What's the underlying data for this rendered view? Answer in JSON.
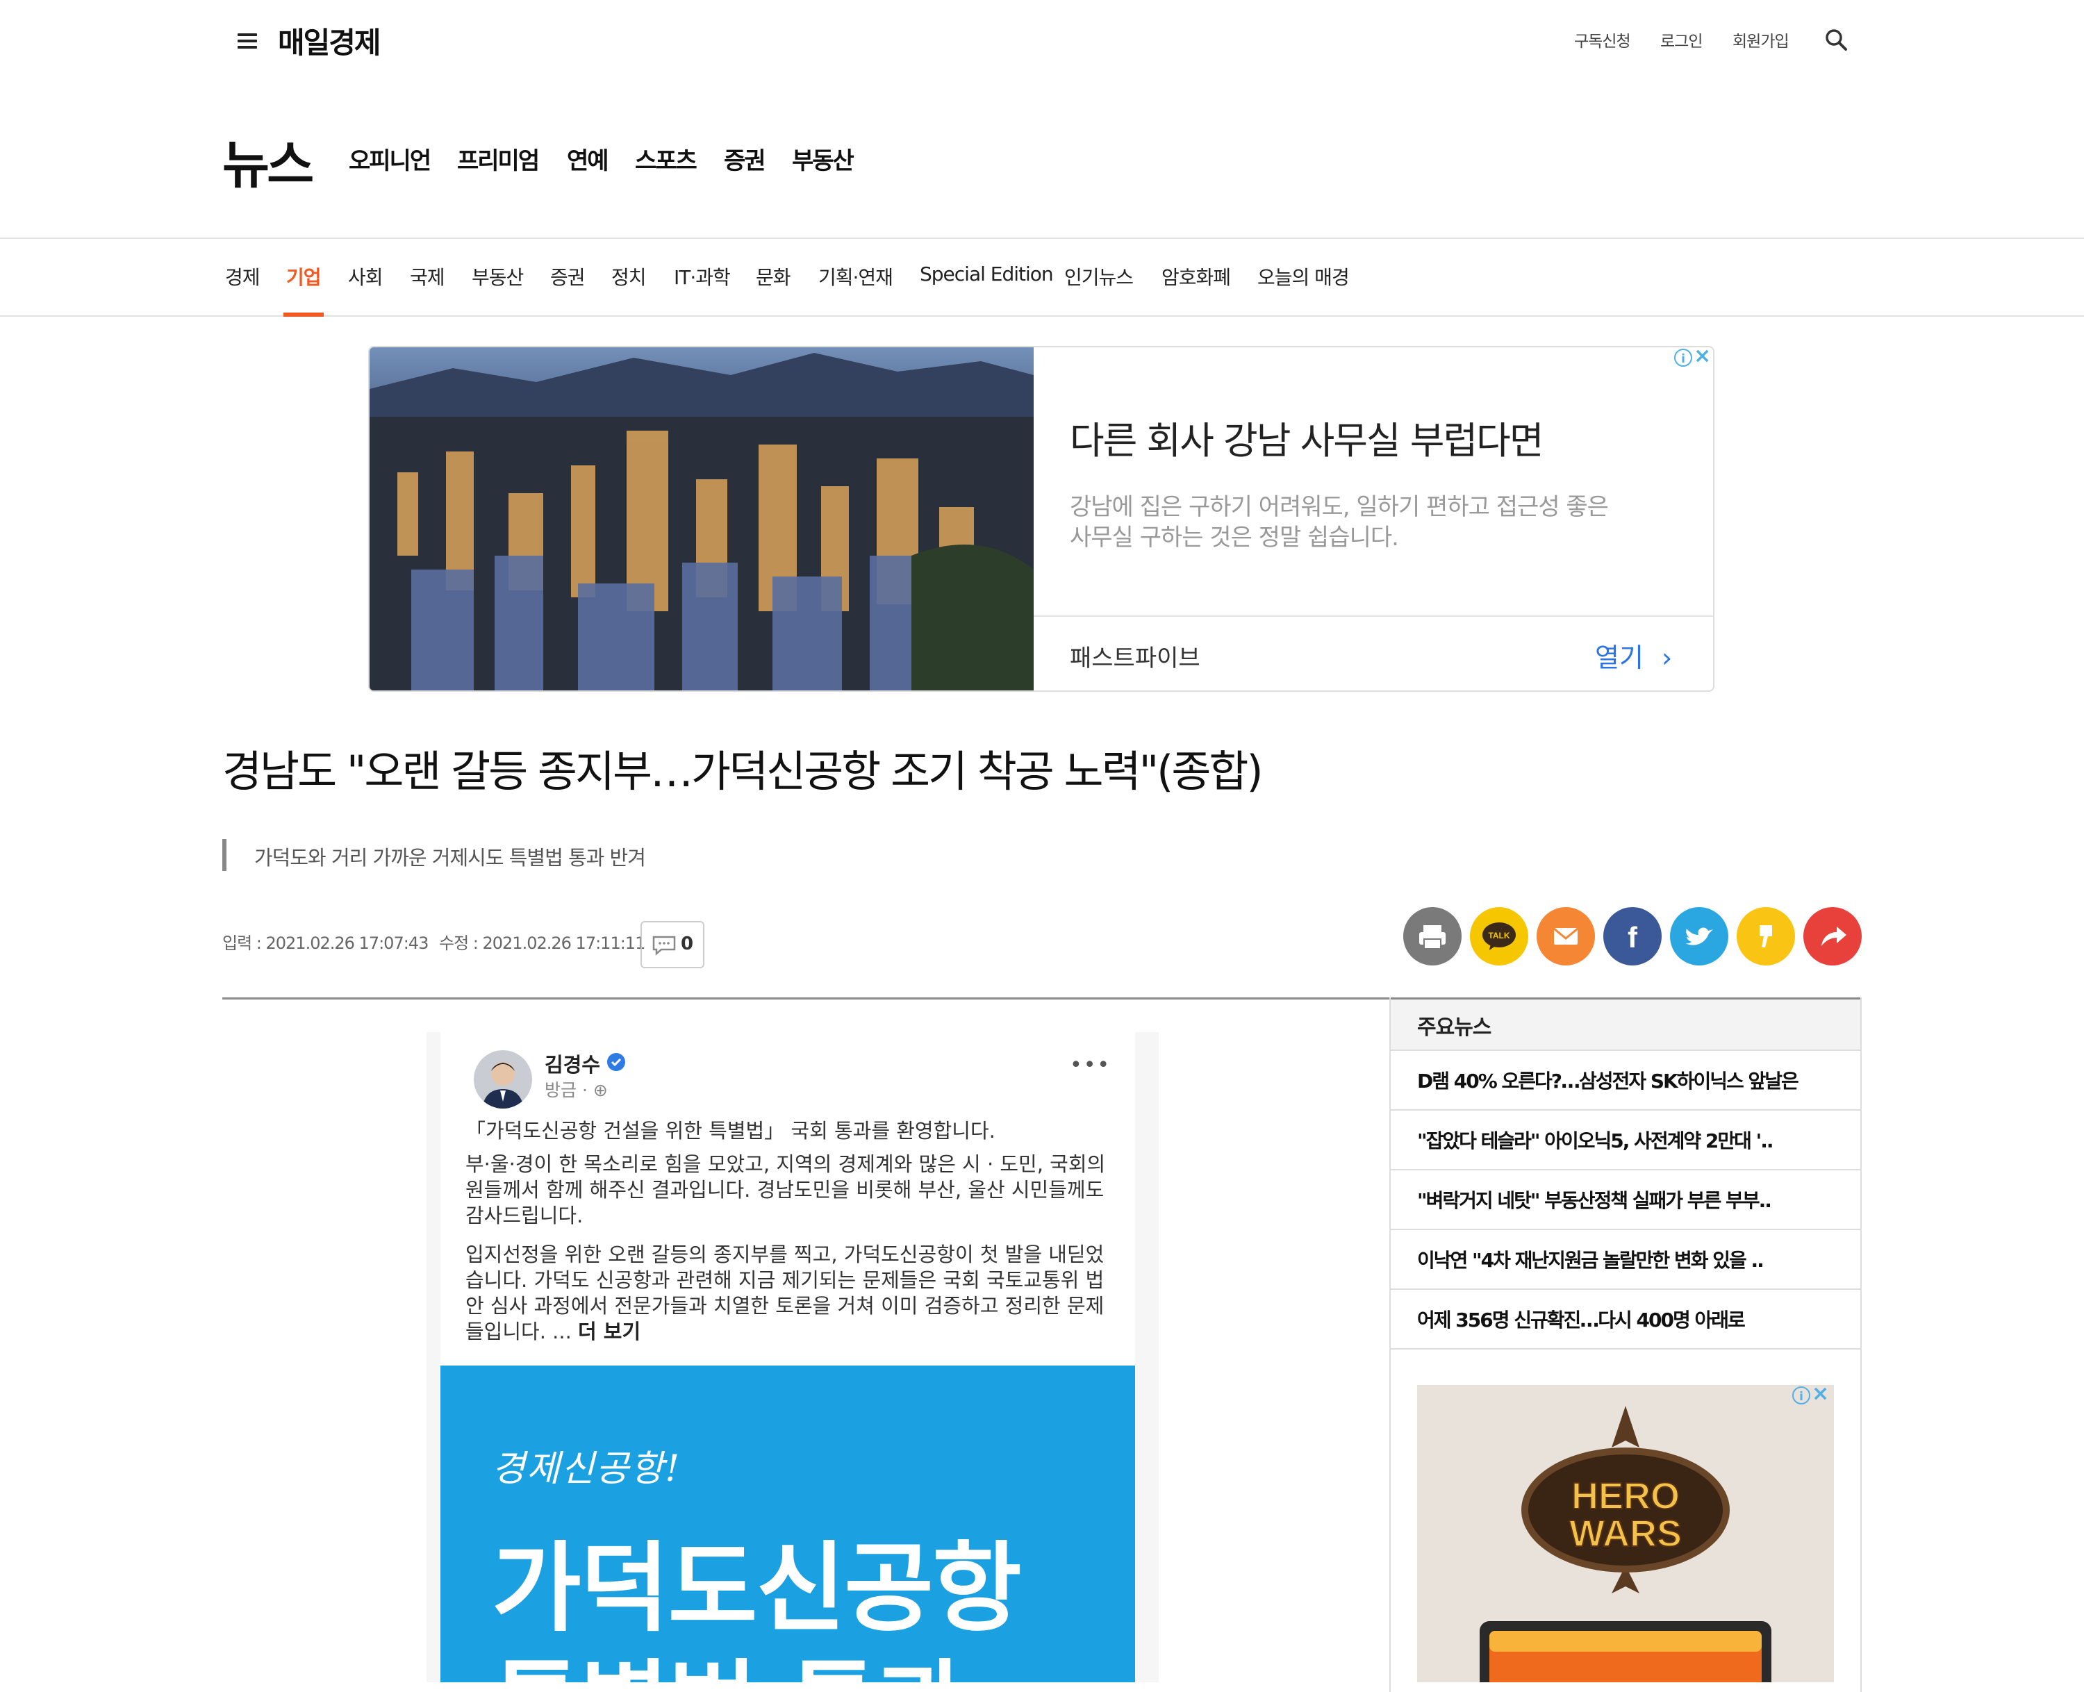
{
  "header": {
    "logo": "매일경제",
    "subscribe": "구독신청",
    "login": "로그인",
    "signup": "회원가입"
  },
  "main_nav": {
    "section": "뉴스",
    "items": [
      "오피니언",
      "프리미엄",
      "연예",
      "스포츠",
      "증권",
      "부동산"
    ]
  },
  "categories": {
    "items": [
      "경제",
      "기업",
      "사회",
      "국제",
      "부동산",
      "증권",
      "정치",
      "IT·과학",
      "문화",
      "기획·연재",
      "Special Edition",
      "인기뉴스",
      "암호화폐",
      "오늘의 매경"
    ],
    "active": "기업",
    "active_color": "#f05a22"
  },
  "ad_banner": {
    "headline": "다른 회사 강남 사무실 부럽다면",
    "description": "강남에 집은 구하기 어려워도, 일하기 편하고 접근성 좋은 사무실 구하는 것은 정말 쉽습니다.",
    "advertiser": "패스트파이브",
    "cta": "열기",
    "info_icon": "info-icon",
    "close_icon": "close-icon"
  },
  "article": {
    "headline": "경남도 \"오랜 갈등 종지부…가덕신공항 조기 착공 노력\"(종합)",
    "subheadline": "가덕도와 거리 가까운 거제시도 특별법 통과 반겨",
    "input_time": "입력 : 2021.02.26 17:07:43",
    "modified_time": "수정 : 2021.02.26 17:11:11",
    "comment_count": "0"
  },
  "share_buttons": [
    {
      "name": "print",
      "color": "#7a7a7a"
    },
    {
      "name": "kakaotalk",
      "color": "#f6c700",
      "label": "TALK"
    },
    {
      "name": "email",
      "color": "#f58634"
    },
    {
      "name": "facebook",
      "color": "#3b5998"
    },
    {
      "name": "twitter",
      "color": "#2aa6e0"
    },
    {
      "name": "kakaostory",
      "color": "#f9c414"
    },
    {
      "name": "share",
      "color": "#e8403a"
    }
  ],
  "article_image": {
    "author": "김경수",
    "time": "방금 ·",
    "paragraph1": "「가덕도신공항 건설을 위한 특별법」 국회 통과를 환영합니다.",
    "paragraph2": "부·울·경이 한 목소리로 힘을 모았고, 지역의 경제계와 많은 시 · 도민, 국회의원들께서 함께 해주신 결과입니다. 경남도민을 비롯해 부산, 울산 시민들께도 감사드립니다.",
    "paragraph3": "입지선정을 위한 오랜 갈등의 종지부를 찍고, 가덕도신공항이 첫 발을 내딛었습니다. 가덕도 신공항과 관련해 지금 제기되는 문제들은 국회 국토교통위 법안 심사 과정에서 전문가들과 치열한 토론을 거쳐 이미 검증하고 정리한 문제들입니다. ...",
    "see_more": "더 보기",
    "banner_script": "경제신공항!",
    "banner_line1": "가덕도신공항",
    "banner_line2": "특별법 통과"
  },
  "sidebar": {
    "title": "주요뉴스",
    "items": [
      "D램 40% 오른다?…삼성전자 SK하이닉스 앞날은",
      "\"잡았다 테슬라\" 아이오닉5, 사전계약 2만대 '..",
      "\"벼락거지 네탓\" 부동산정책 실패가 부른 부부..",
      "이낙연 \"4차 재난지원금 놀랄만한 변화 있을 ..",
      "어제 356명 신규확진…다시 400명 아래로"
    ],
    "ad_game": "HERO WARS"
  }
}
